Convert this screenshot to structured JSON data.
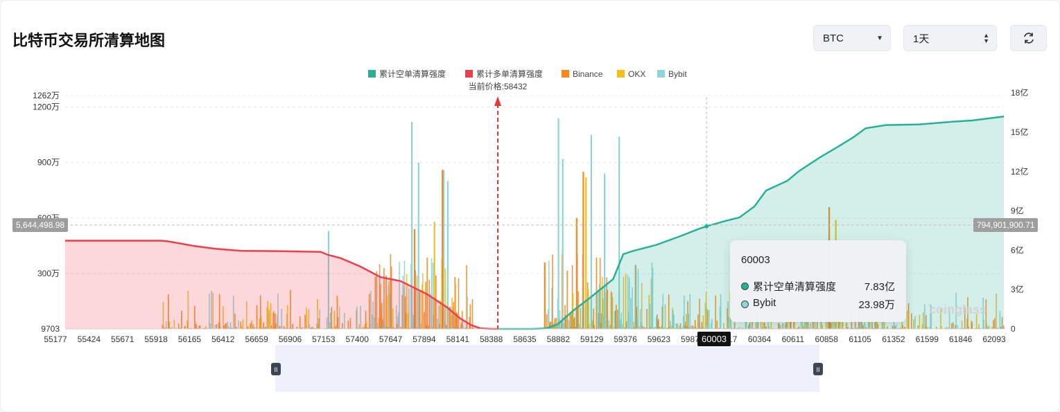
{
  "header": {
    "title": "比特币交易所清算地图"
  },
  "controls": {
    "coin_value": "BTC",
    "range_value": "1天",
    "refresh_icon": "refresh-icon",
    "caret_icon": "caret-down-icon",
    "updown_icon": "updown-arrows-icon"
  },
  "colors": {
    "short_cum": "#26b095",
    "long_cum": "#ef3d4a",
    "binance": "#f5891f",
    "okx": "#f2bf1c",
    "bybit": "#8fd4d6",
    "price_line": "#e53935"
  },
  "tooltip": {
    "title": "60003",
    "rows": [
      {
        "name": "累计空单清算强度",
        "value": "7.83亿",
        "color": "#26b095"
      },
      {
        "name": "Bybit",
        "value": "23.98万",
        "color": "#8fd4d6"
      }
    ]
  },
  "crosshair": {
    "left_value": "5,644,498.98",
    "right_value": "794,901,900.71",
    "x_value": "60003"
  },
  "watermark": "coinglass",
  "chart_data": {
    "type": "bar",
    "legend": [
      "累计空单清算强度",
      "累计多单清算强度",
      "Binance",
      "OKX",
      "Bybit"
    ],
    "legend_position": "top-center",
    "current_price_label": "当前价格:58432",
    "current_price": 58432,
    "x_ticks": [
      "55177",
      "55424",
      "55671",
      "55918",
      "56165",
      "56412",
      "56659",
      "56906",
      "57153",
      "57400",
      "57647",
      "57894",
      "58141",
      "58388",
      "58635",
      "58882",
      "59129",
      "59376",
      "59623",
      "59870",
      "60117",
      "60364",
      "60611",
      "60858",
      "61105",
      "61352",
      "61599",
      "61846",
      "62093"
    ],
    "xlim": [
      55177,
      62240
    ],
    "y_left": {
      "ticks": [
        "9703",
        "300万",
        "600万",
        "900万",
        "1200万",
        "1262万"
      ],
      "values": [
        9703,
        3000000,
        6000000,
        9000000,
        12000000,
        12620000
      ],
      "lim": [
        9703,
        12620000
      ]
    },
    "y_right": {
      "ticks": [
        "0",
        "3亿",
        "6亿",
        "9亿",
        "12亿",
        "15亿",
        "18亿"
      ],
      "values": [
        0,
        300000000,
        600000000,
        900000000,
        1200000000,
        1500000000,
        1800000000
      ],
      "lim": [
        0,
        1780000000
      ]
    },
    "grid": true,
    "series": [
      {
        "name": "累计多单清算强度",
        "axis": "right",
        "x": [
          55177,
          55900,
          55950,
          56050,
          56150,
          56300,
          56500,
          56800,
          57100,
          57153,
          57250,
          57400,
          57550,
          57700,
          57900,
          58050,
          58150,
          58230,
          58300,
          58388,
          58432
        ],
        "y": [
          673000000,
          673000000,
          668000000,
          650000000,
          632000000,
          612000000,
          596000000,
          593000000,
          588000000,
          565000000,
          540000000,
          475000000,
          395000000,
          365000000,
          265000000,
          165000000,
          80000000,
          30000000,
          5000000,
          0,
          0
        ]
      },
      {
        "name": "累计空单清算强度",
        "axis": "right",
        "x": [
          58432,
          58700,
          58800,
          58882,
          59000,
          59129,
          59300,
          59376,
          59450,
          59623,
          59800,
          59950,
          60003,
          60150,
          60250,
          60364,
          60450,
          60611,
          60700,
          60858,
          61000,
          61105,
          61200,
          61352,
          61600,
          61846,
          62000,
          62240
        ],
        "y": [
          0,
          0,
          5000000,
          35000000,
          140000000,
          240000000,
          380000000,
          570000000,
          595000000,
          640000000,
          705000000,
          765000000,
          783000000,
          825000000,
          850000000,
          935000000,
          1055000000,
          1130000000,
          1205000000,
          1310000000,
          1395000000,
          1460000000,
          1530000000,
          1555000000,
          1560000000,
          1580000000,
          1590000000,
          1620000000
        ]
      },
      {
        "name": "Bybit",
        "axis": "left",
        "peaks": [
          {
            "x": 57780,
            "y": 11200000
          },
          {
            "x": 57830,
            "y": 9000000
          },
          {
            "x": 58020,
            "y": 8600000
          },
          {
            "x": 58050,
            "y": 8000000
          },
          {
            "x": 58883,
            "y": 11400000
          },
          {
            "x": 58915,
            "y": 9200000
          },
          {
            "x": 59130,
            "y": 10500000
          },
          {
            "x": 59340,
            "y": 10400000
          },
          {
            "x": 59230,
            "y": 8400000
          },
          {
            "x": 57153,
            "y": 5300000
          },
          {
            "x": 60003,
            "y": 239800
          }
        ]
      },
      {
        "name": "Binance",
        "axis": "left",
        "peaks": [
          {
            "x": 58010,
            "y": 8600000
          },
          {
            "x": 57800,
            "y": 5400000
          },
          {
            "x": 59070,
            "y": 8500000
          },
          {
            "x": 59020,
            "y": 6000000
          },
          {
            "x": 60920,
            "y": 6600000
          },
          {
            "x": 58780,
            "y": 3600000
          }
        ]
      },
      {
        "name": "OKX",
        "axis": "left",
        "peaks": [
          {
            "x": 57950,
            "y": 5800000
          },
          {
            "x": 59090,
            "y": 8200000
          },
          {
            "x": 60970,
            "y": 5900000
          }
        ]
      }
    ]
  }
}
